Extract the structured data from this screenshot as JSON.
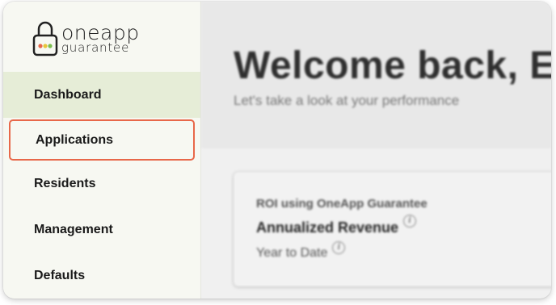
{
  "brand": {
    "line1": "oneapp",
    "line2": "guarantee"
  },
  "sidebar": {
    "items": [
      {
        "label": "Dashboard"
      },
      {
        "label": "Applications"
      },
      {
        "label": "Residents"
      },
      {
        "label": "Management"
      },
      {
        "label": "Defaults"
      }
    ]
  },
  "main": {
    "welcome": "Welcome back, E",
    "subtitle": "Let's take a look at your performance",
    "card": {
      "kicker": "ROI using OneApp Guarantee",
      "metric": "Annualized Revenue",
      "period": "Year to Date"
    }
  },
  "colors": {
    "active_nav_bg": "#e6edd7",
    "focus_border": "#e8684a",
    "lock_dot_red": "#e8684a",
    "lock_dot_yellow": "#e8c53a",
    "lock_dot_green": "#7bbf4e"
  },
  "icons": {
    "info": "info-icon",
    "logo": "padlock-icon"
  }
}
